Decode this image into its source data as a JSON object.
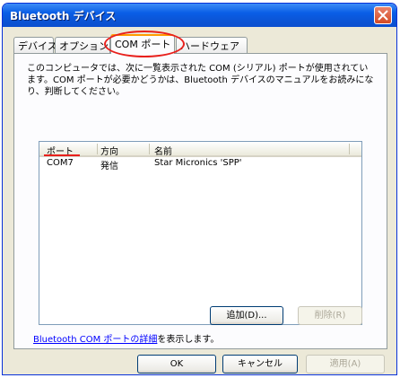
{
  "window": {
    "title": "Bluetooth デバイス"
  },
  "tabs": [
    {
      "label": "デバイス",
      "active": false
    },
    {
      "label": "オプション",
      "active": false
    },
    {
      "label": "COM ポート",
      "active": true
    },
    {
      "label": "ハードウェア",
      "active": false
    }
  ],
  "panel": {
    "description": "このコンピュータでは、次に一覧表示された COM (シリアル) ポートが使用されています。COM ポートが必要かどうかは、Bluetooth デバイスのマニュアルをお読みになり、判断してください。",
    "list": {
      "columns": [
        "ポート",
        "方向",
        "名前"
      ],
      "rows": [
        {
          "port": "COM7",
          "direction": "発信",
          "name": "Star Micronics 'SPP'"
        }
      ]
    },
    "add_button": "追加(D)...",
    "remove_button": "削除(R)",
    "link_prefix": "Bluetooth COM ポートの詳細",
    "link_suffix": "を表示します。"
  },
  "footer": {
    "ok": "OK",
    "cancel": "キャンセル",
    "apply": "適用(A)"
  },
  "colors": {
    "highlight": "#e8201c",
    "titlebar": "#0a5ee6"
  }
}
